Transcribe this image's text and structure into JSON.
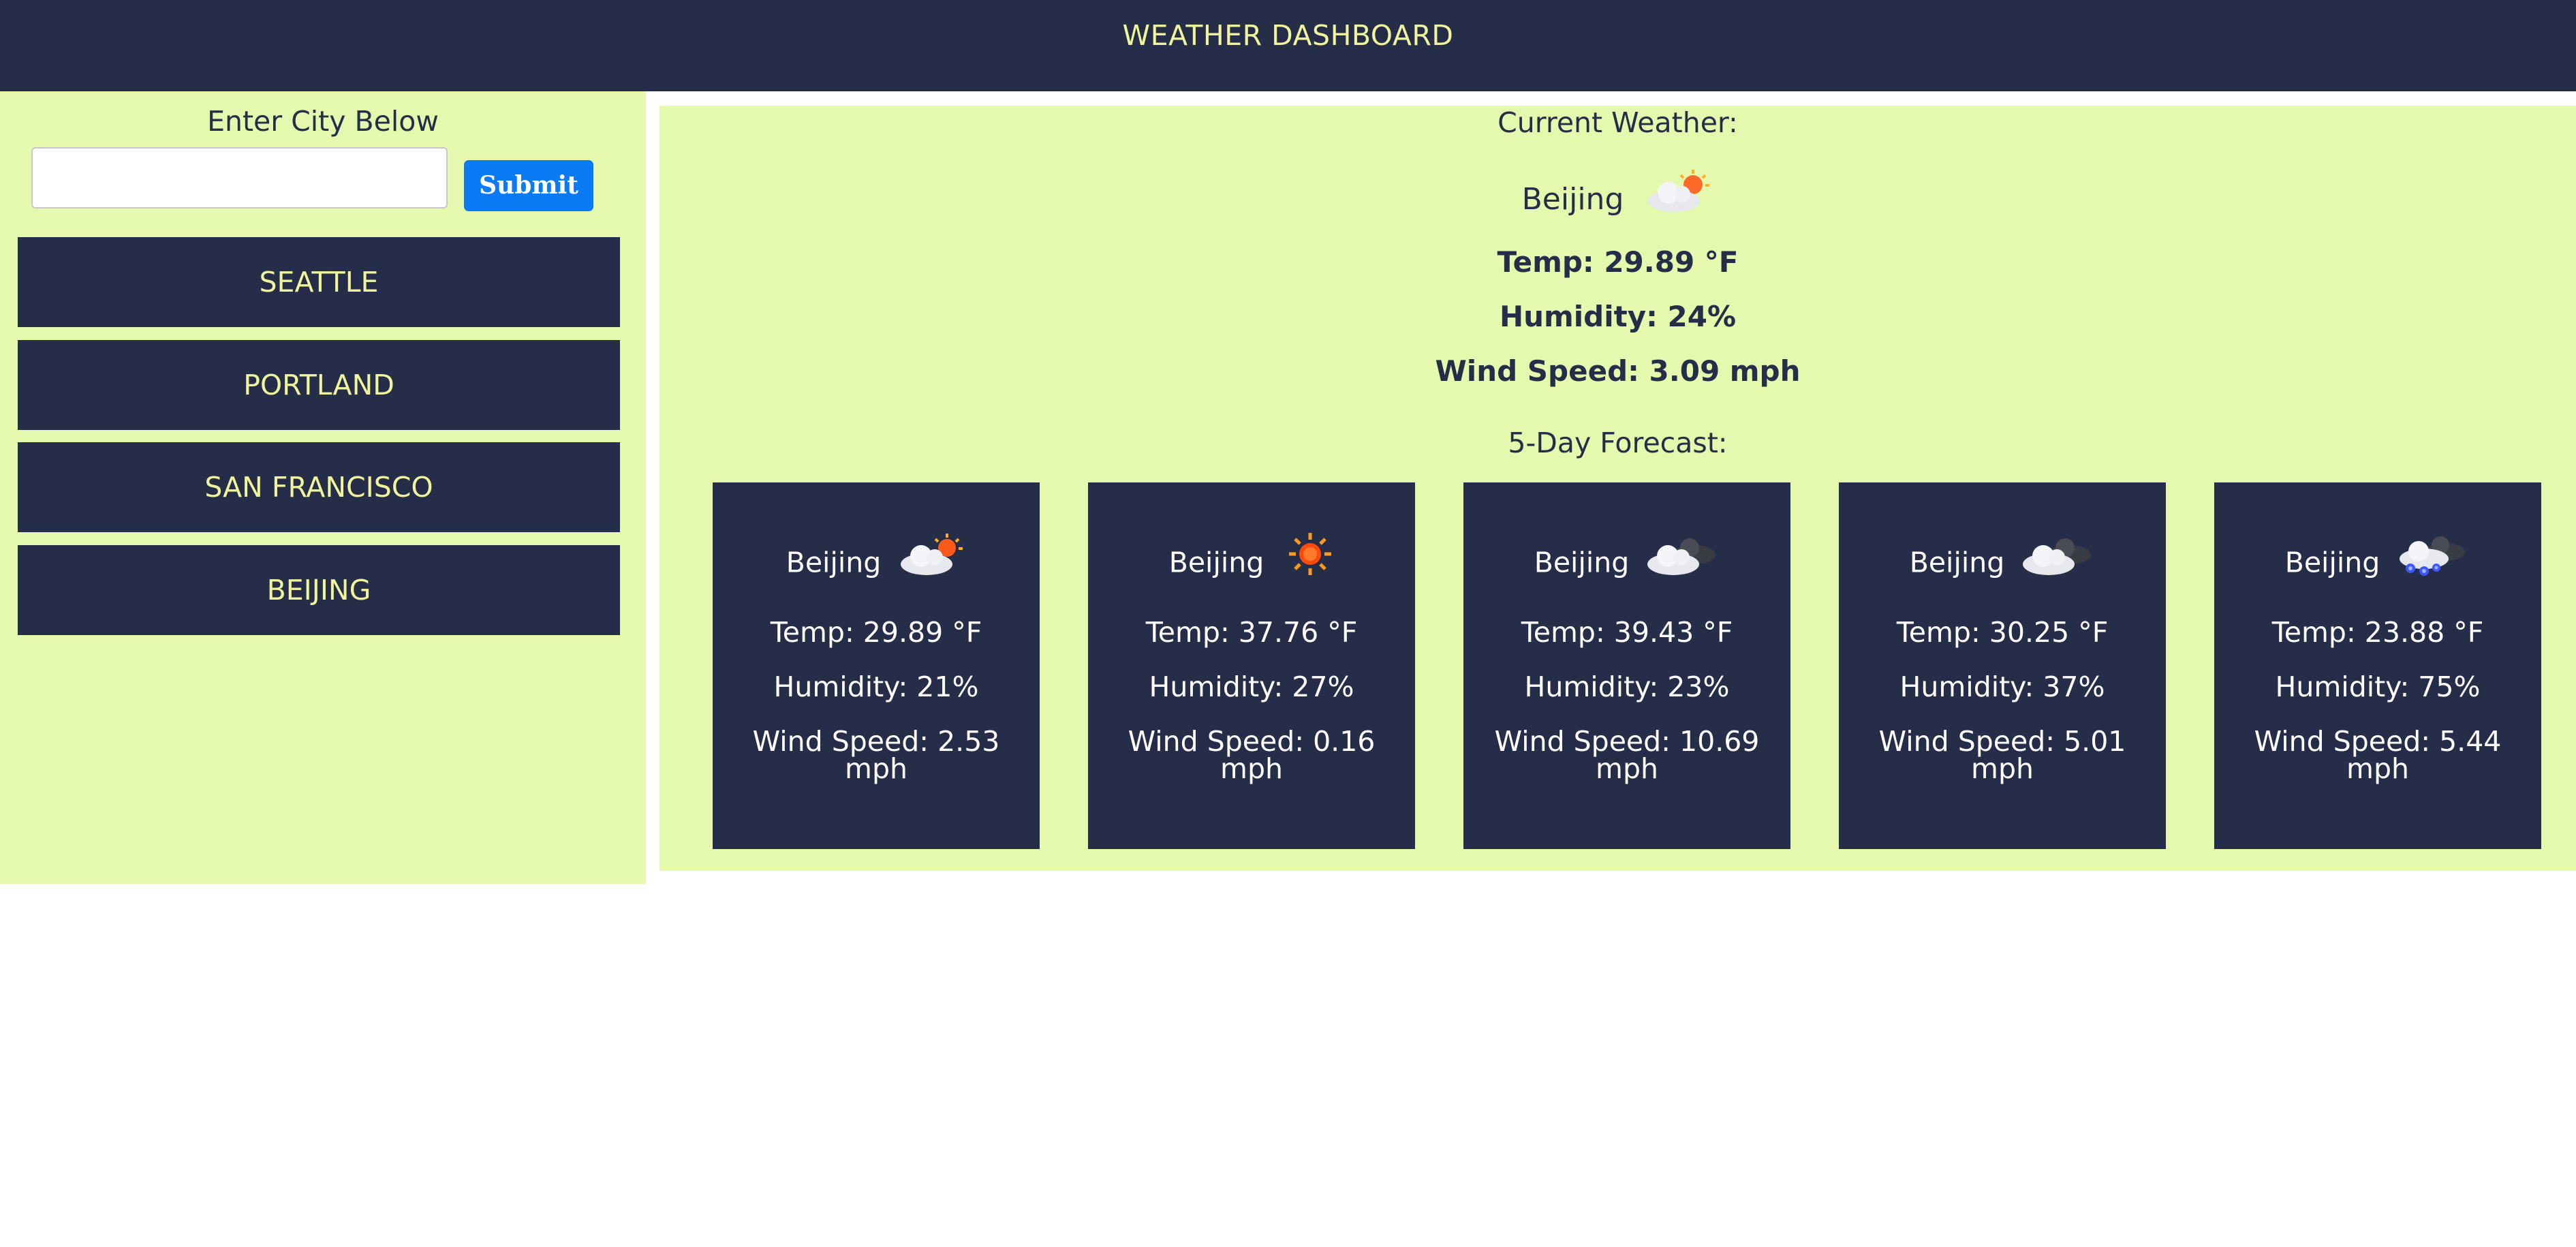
{
  "header": {
    "title": "WEATHER DASHBOARD"
  },
  "search": {
    "label": "Enter City Below",
    "input_value": "",
    "submit_label": "Submit"
  },
  "cities": [
    "SEATTLE",
    "PORTLAND",
    "SAN FRANCISCO",
    "BEIJING"
  ],
  "current": {
    "title": "Current Weather:",
    "city": "Beijing",
    "icon": "partly-cloudy-icon",
    "temp": "Temp: 29.89 °F",
    "humidity": "Humidity: 24%",
    "wind": "Wind Speed: 3.09 mph"
  },
  "forecast": {
    "title": "5-Day Forecast:",
    "days": [
      {
        "city": "Beijing",
        "icon": "partly-cloudy-icon",
        "temp": "Temp: 29.89 °F",
        "humidity": "Humidity: 21%",
        "wind": "Wind Speed: 2.53 mph"
      },
      {
        "city": "Beijing",
        "icon": "sun-icon",
        "temp": "Temp: 37.76 °F",
        "humidity": "Humidity: 27%",
        "wind": "Wind Speed: 0.16 mph"
      },
      {
        "city": "Beijing",
        "icon": "cloudy-icon",
        "temp": "Temp: 39.43 °F",
        "humidity": "Humidity: 23%",
        "wind": "Wind Speed: 10.69 mph"
      },
      {
        "city": "Beijing",
        "icon": "cloudy-icon",
        "temp": "Temp: 30.25 °F",
        "humidity": "Humidity: 37%",
        "wind": "Wind Speed: 5.01 mph"
      },
      {
        "city": "Beijing",
        "icon": "snow-icon",
        "temp": "Temp: 23.88 °F",
        "humidity": "Humidity: 75%",
        "wind": "Wind Speed: 5.44 mph"
      }
    ]
  },
  "colors": {
    "navy": "#252d48",
    "lime": "#e4f8ae",
    "accent_text": "#f0f59c",
    "button_blue": "#0b7af5"
  }
}
